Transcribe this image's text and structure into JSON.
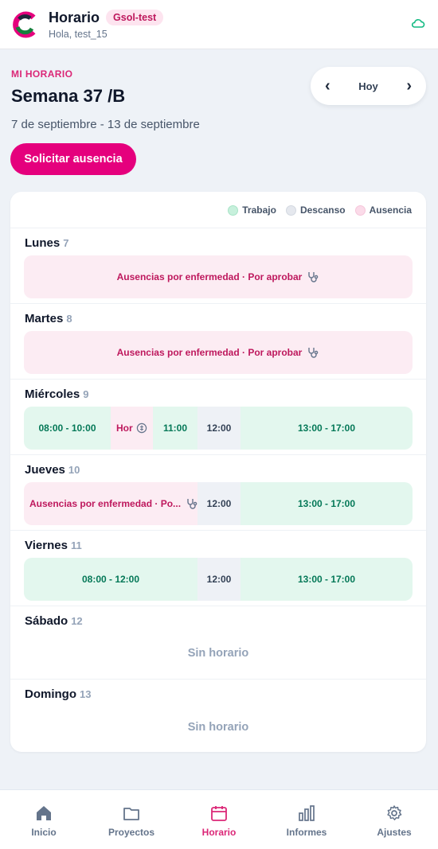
{
  "header": {
    "title": "Horario",
    "tenant": "Gsol-test",
    "greeting": "Hola, test_15",
    "logo_icon": "brand-logo",
    "sync_icon": "cloud-icon"
  },
  "week": {
    "eyebrow": "MI HORARIO",
    "title": "Semana 37 /B",
    "range": "7 de septiembre - 13 de septiembre",
    "today_label": "Hoy",
    "prev_label": "‹",
    "next_label": "›",
    "request_absence_label": "Solicitar ausencia"
  },
  "legend": {
    "work": "Trabajo",
    "rest": "Descanso",
    "absence": "Ausencia"
  },
  "days": [
    {
      "name": "Lunes",
      "num": "7",
      "absence": "Ausencias por enfermedad · Por aprobar"
    },
    {
      "name": "Martes",
      "num": "8",
      "absence": "Ausencias por enfermedad · Por aprobar"
    },
    {
      "name": "Miércoles",
      "num": "9",
      "segments": [
        "08:00 - 10:00",
        "Hor",
        "11:00",
        "12:00",
        "13:00 - 17:00"
      ]
    },
    {
      "name": "Jueves",
      "num": "10",
      "segments": [
        "Ausencias por enfermedad · Po...",
        "12:00",
        "13:00 - 17:00"
      ]
    },
    {
      "name": "Viernes",
      "num": "11",
      "segments": [
        "08:00 - 12:00",
        "12:00",
        "13:00 - 17:00"
      ]
    },
    {
      "name": "Sábado",
      "num": "12",
      "empty": "Sin horario"
    },
    {
      "name": "Domingo",
      "num": "13",
      "empty": "Sin horario"
    }
  ],
  "bottom_nav": [
    {
      "label": "Inicio",
      "icon": "home-icon"
    },
    {
      "label": "Proyectos",
      "icon": "folder-icon"
    },
    {
      "label": "Horario",
      "icon": "calendar-icon",
      "active": true
    },
    {
      "label": "Informes",
      "icon": "bar-chart-icon"
    },
    {
      "label": "Ajustes",
      "icon": "gear-icon"
    }
  ],
  "colors": {
    "accent": "#e5007d",
    "work_bg": "#e3f7ee",
    "rest_bg": "#eef1f6",
    "absence_bg": "#fcecf3"
  }
}
